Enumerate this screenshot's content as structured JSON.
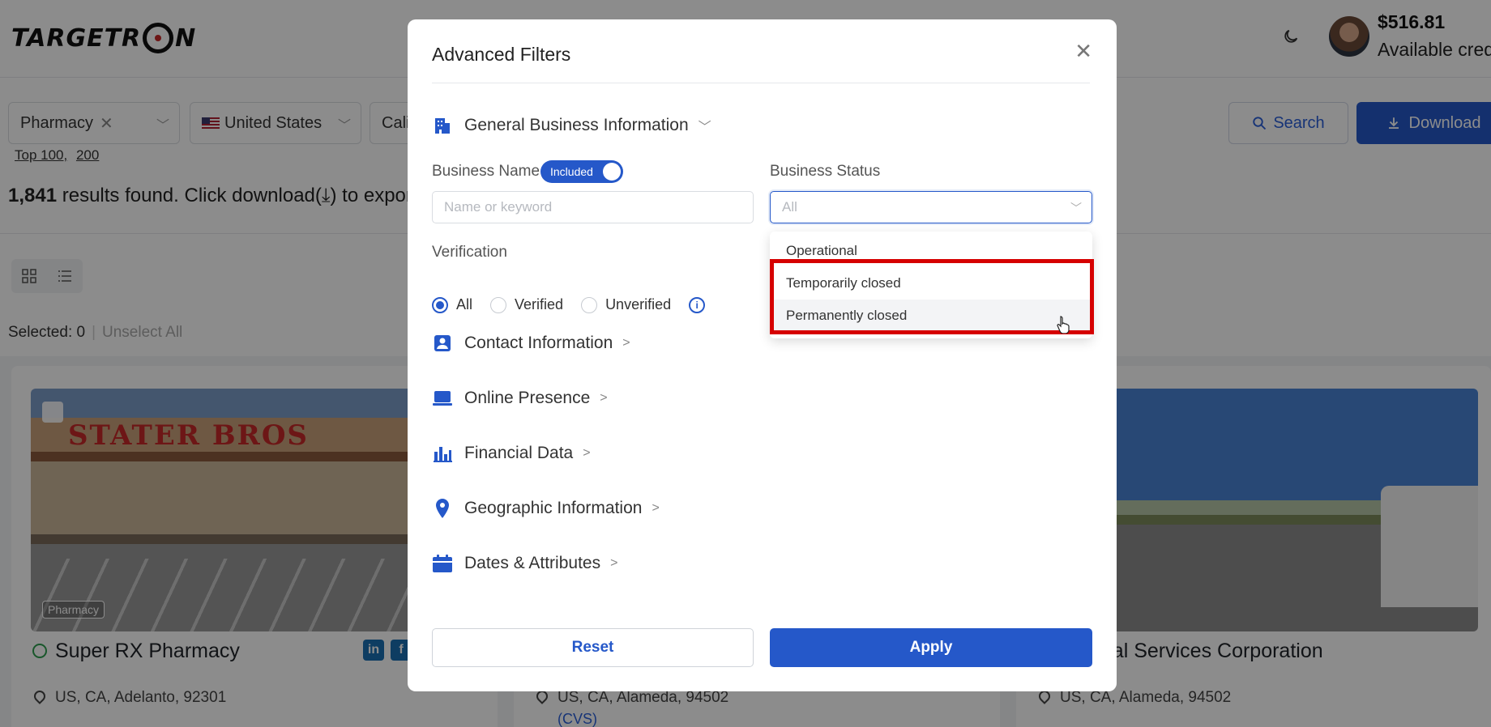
{
  "app": {
    "logo_text_left": "TARGETR",
    "logo_text_right": "N",
    "credit_amount": "$516.81",
    "credit_label": "Available cred"
  },
  "filters_bar": {
    "chips": [
      {
        "label": "Pharmacy"
      },
      {
        "label": "United States"
      },
      {
        "label": "Cali"
      }
    ],
    "top_links": [
      "Top 100,",
      "200"
    ],
    "search_label": "Search",
    "download_label": "Download"
  },
  "results": {
    "count": "1,841",
    "text": " results found. Click download(",
    "text_tail": ") to export a"
  },
  "selection": {
    "selected_label": "Selected: 0",
    "unselect_label": "Unselect All"
  },
  "cards": [
    {
      "title": "Super RX Pharmacy",
      "address": "US, CA, Adelanto, 92301",
      "badge": "Pharmacy",
      "sign": "STATER BROS"
    },
    {
      "title": "",
      "address": "US, CA, Alameda, 94502",
      "link": "(CVS)"
    },
    {
      "title": "eutical Services Corporation",
      "address": "US, CA, Alameda, 94502"
    }
  ],
  "modal": {
    "title": "Advanced Filters",
    "sections": {
      "general": "General Business Information",
      "contact": "Contact Information",
      "online": "Online Presence",
      "financial": "Financial Data",
      "geographic": "Geographic Information",
      "dates": "Dates & Attributes"
    },
    "business_name_label": "Business Name",
    "included_toggle": "Included",
    "name_placeholder": "Name or keyword",
    "business_status_label": "Business Status",
    "business_status_value": "All",
    "status_options": [
      "Operational",
      "Temporarily closed",
      "Permanently closed"
    ],
    "verification_label": "Verification",
    "verification_options": [
      "All",
      "Verified",
      "Unverified"
    ],
    "verification_selected": "All",
    "reset_label": "Reset",
    "apply_label": "Apply"
  },
  "colors": {
    "primary": "#2558c9",
    "highlight": "#d60000",
    "success": "#2e9e4f"
  }
}
